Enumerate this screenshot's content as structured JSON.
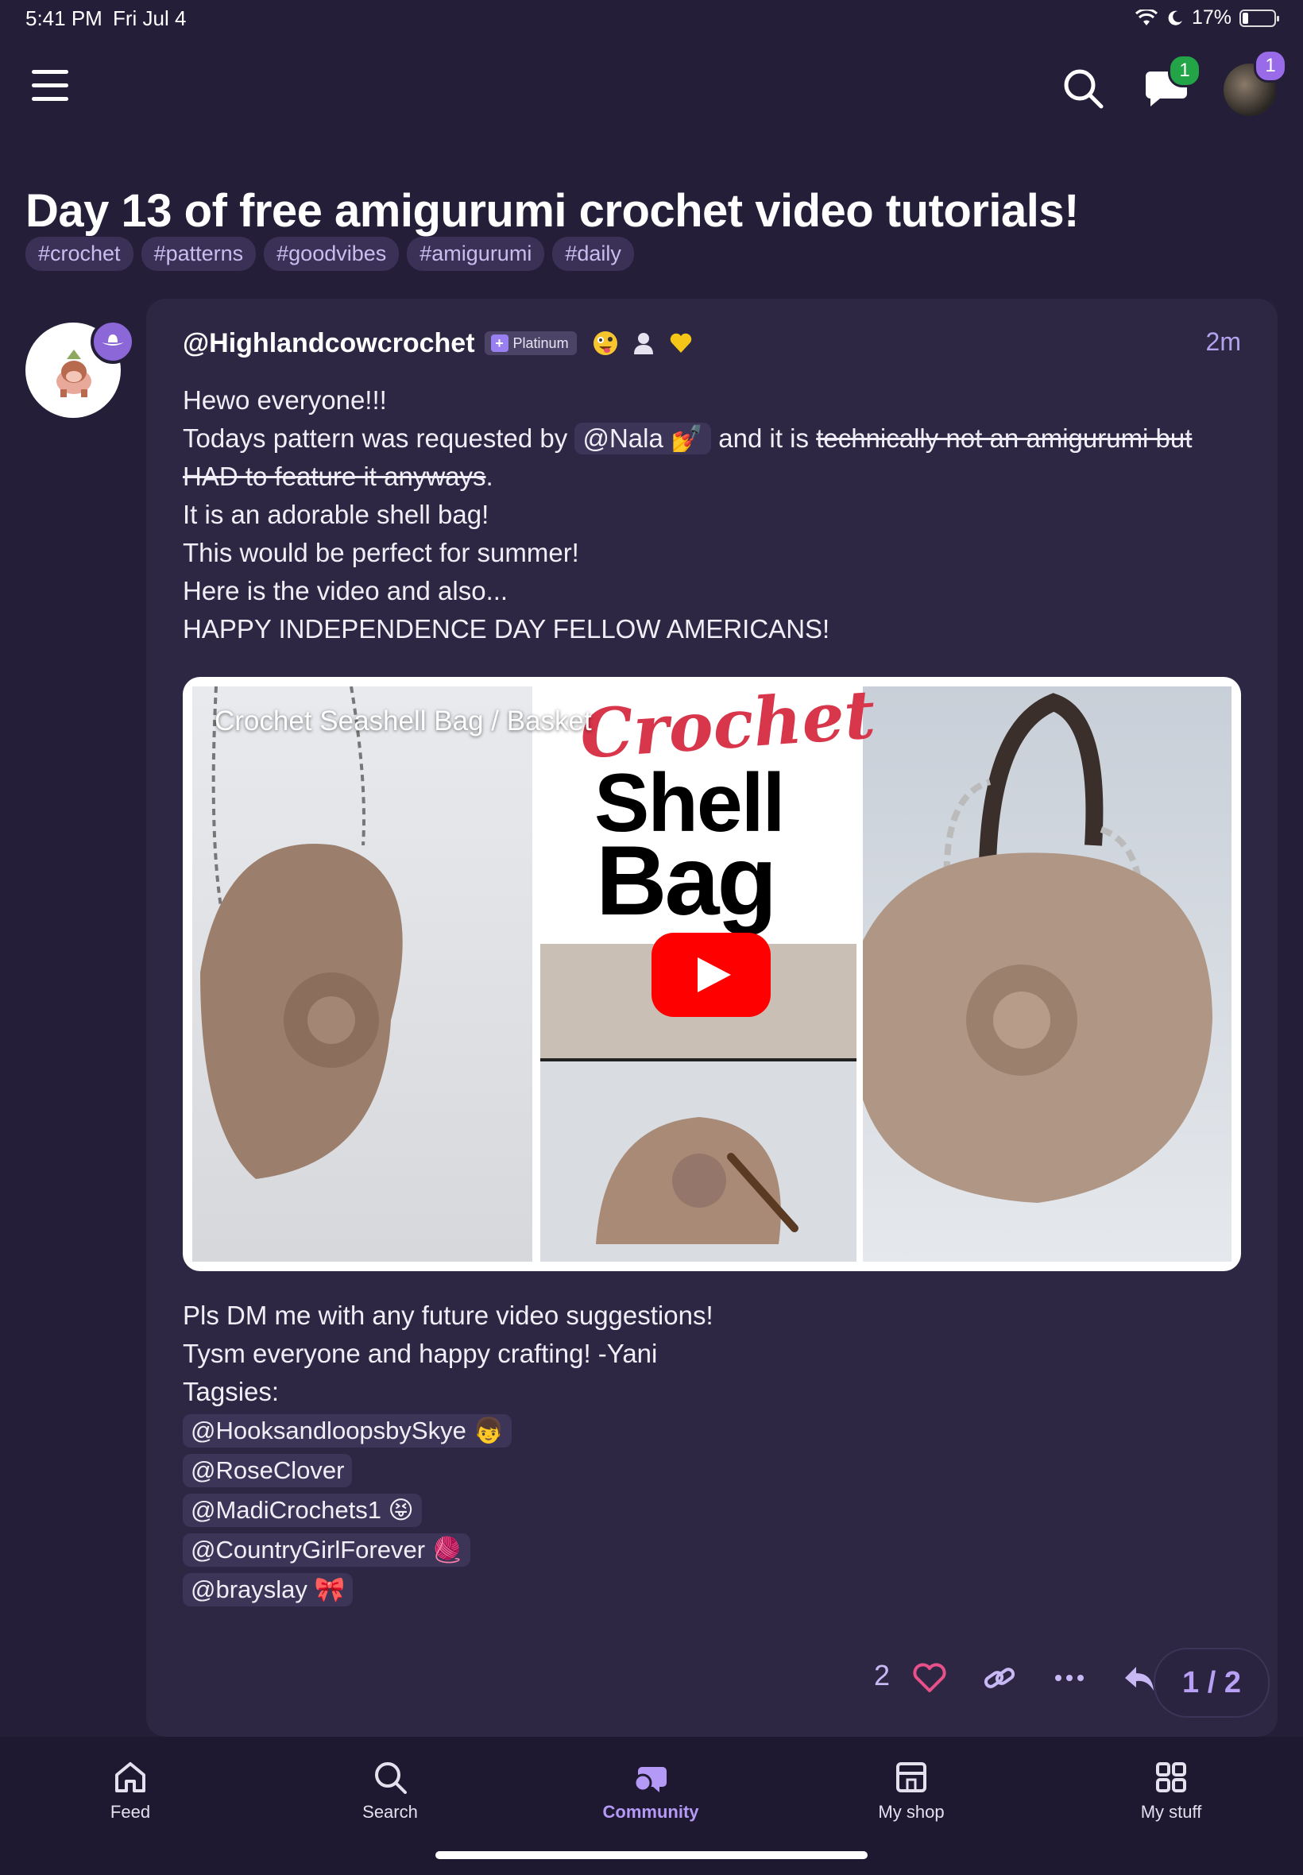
{
  "status_bar": {
    "time": "5:41 PM",
    "date": "Fri Jul 4",
    "battery": "17%"
  },
  "header": {
    "chat_badge": "1",
    "profile_badge": "1"
  },
  "post": {
    "title": "Day 13 of free amigurumi crochet video tutorials!",
    "tags": [
      "#crochet",
      "#patterns",
      "#goodvibes",
      "#amigurumi",
      "#daily"
    ],
    "author": {
      "username": "@Highlandcowcrochet",
      "badge_label": "Platinum",
      "flair": [
        "silly-face-emoji",
        "person-icon",
        "yellow-heart-icon"
      ]
    },
    "time_ago": "2m",
    "body_lines": {
      "line1": "Hewo everyone!!!",
      "line2_prefix": "Todays pattern was requested by",
      "line2_mention": "@Nala 💅",
      "line2_mid": "and it is",
      "line2_strike": "technically not an amigurumi but HAD to feature it anyways",
      "line2_end": ".",
      "line3": "It is an adorable shell bag!",
      "line4": "This would be perfect for summer!",
      "line5": "Here is the video and also...",
      "line6": "HAPPY INDEPENDENCE DAY FELLOW AMERICANS!"
    },
    "video": {
      "title": "Crochet Seashell Bag / Basket",
      "thumb_word1": "Crochet",
      "thumb_word2": "Shell",
      "thumb_word3": "Bag"
    },
    "footer_lines": {
      "line1": "Pls DM me with any future video suggestions!",
      "line2": "Tysm everyone and happy crafting! -Yani",
      "line3": "Tagsies:"
    },
    "mentions": [
      "@HooksandloopsbySkye 👦",
      "@RoseClover",
      "@MadiCrochets1 😝",
      "@CountryGirlForever 🧶",
      "@brayslay 🎀"
    ],
    "likes": "2",
    "pager": "1 / 2"
  },
  "bottom_nav": [
    {
      "label": "Feed",
      "icon": "home-icon",
      "active": false
    },
    {
      "label": "Search",
      "icon": "search-icon",
      "active": false
    },
    {
      "label": "Community",
      "icon": "community-icon",
      "active": true
    },
    {
      "label": "My shop",
      "icon": "shop-icon",
      "active": false
    },
    {
      "label": "My stuff",
      "icon": "grid-icon",
      "active": false
    }
  ],
  "colors": {
    "background": "#241e38",
    "card": "#2d2744",
    "accent": "#b49af6",
    "tag_bg": "#3b3156"
  }
}
